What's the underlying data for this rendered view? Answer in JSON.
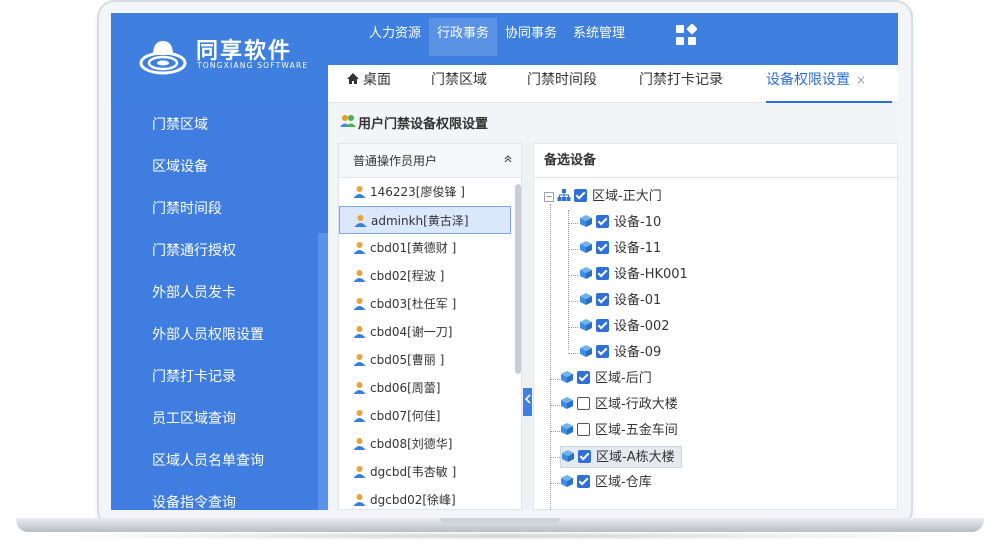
{
  "app": {
    "brand": "同享软件",
    "brand_sub": "TONGXIANG SOFTWARE"
  },
  "topnav": [
    "人力资源",
    "行政事务",
    "协同事务",
    "系统管理"
  ],
  "topnav_active": 1,
  "sidebar": {
    "items": [
      "门禁区域",
      "区域设备",
      "门禁时间段",
      "门禁通行授权",
      "外部人员发卡",
      "外部人员权限设置",
      "门禁打卡记录",
      "员工区域查询",
      "区域人员名单查询",
      "设备指令查询"
    ]
  },
  "tabs": [
    {
      "label": "桌面",
      "icon": "home-icon"
    },
    {
      "label": "门禁区域"
    },
    {
      "label": "门禁时间段"
    },
    {
      "label": "门禁打卡记录"
    },
    {
      "label": "设备权限设置",
      "closable": true,
      "active": true
    }
  ],
  "tab_close": "×",
  "panel": {
    "title": "用户门禁设备权限设置",
    "users_header": "普通操作员用户",
    "collapse": "⌃",
    "devices_header": "备选设备"
  },
  "users": [
    "146223[廖俊锋 ]",
    "adminkh[黄古泽]",
    "cbd01[黄德财 ]",
    "cbd02[程波 ]",
    "cbd03[杜任军 ]",
    "cbd04[谢一刀]",
    "cbd05[曹丽 ]",
    "cbd06[周蕾]",
    "cbd07[何佳]",
    "cbd08[刘德华]",
    "dgcbd[韦杏敏 ]",
    "dgcbd02[徐峰]"
  ],
  "selected_user": 1,
  "tree": {
    "root": {
      "label": "区域-正大门",
      "checked": true,
      "expander": "⊟"
    },
    "root_devices": [
      {
        "label": "设备-10",
        "checked": true
      },
      {
        "label": "设备-11",
        "checked": true
      },
      {
        "label": "设备-HK001",
        "checked": true
      },
      {
        "label": "设备-01",
        "checked": true
      },
      {
        "label": "设备-002",
        "checked": true
      },
      {
        "label": "设备-09",
        "checked": true
      }
    ],
    "areas": [
      {
        "label": "区域-后门",
        "checked": true
      },
      {
        "label": "区域-行政大楼",
        "checked": false
      },
      {
        "label": "区域-五金车间",
        "checked": false
      },
      {
        "label": "区域-A栋大楼",
        "checked": true,
        "highlighted": true
      },
      {
        "label": "区域-仓库",
        "checked": true
      }
    ]
  },
  "colors": {
    "primary": "#3e7fe0",
    "checkbox": "#2f6fd6",
    "tab_active": "#2a6ed8"
  }
}
